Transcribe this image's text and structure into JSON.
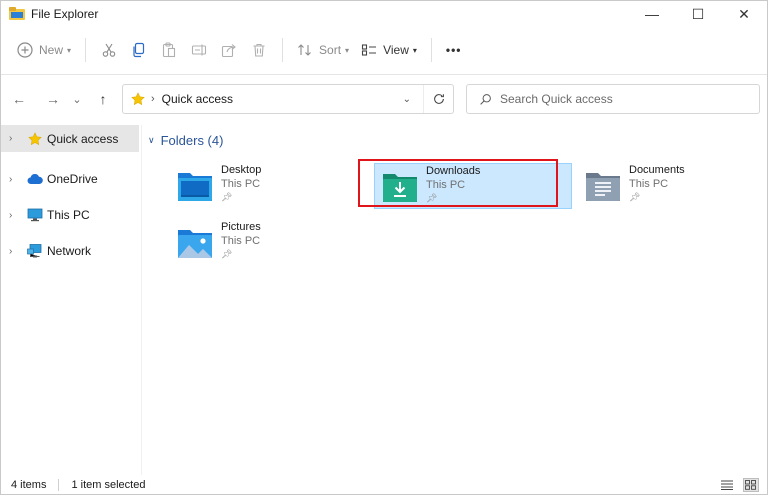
{
  "window": {
    "title": "File Explorer",
    "controls": {
      "minimize": "—",
      "maximize": "☐",
      "close": "✕"
    }
  },
  "toolbar": {
    "new_label": "New",
    "sort_label": "Sort",
    "view_label": "View",
    "more_label": "•••",
    "icons": [
      "cut-icon",
      "copy-icon",
      "paste-icon",
      "rename-icon",
      "share-icon",
      "delete-icon"
    ]
  },
  "nav": {
    "back": "←",
    "forward": "→",
    "recent": "⌄",
    "up": "↑"
  },
  "address": {
    "location": "Quick access"
  },
  "search": {
    "placeholder": "Search Quick access"
  },
  "sidebar": {
    "items": [
      {
        "label": "Quick access",
        "icon": "star-icon",
        "selected": true
      },
      {
        "label": "OneDrive",
        "icon": "cloud-icon",
        "selected": false
      },
      {
        "label": "This PC",
        "icon": "monitor-icon",
        "selected": false
      },
      {
        "label": "Network",
        "icon": "network-icon",
        "selected": false
      }
    ]
  },
  "main": {
    "group_header": "Folders (4)",
    "folders": [
      {
        "name": "Desktop",
        "location": "This PC",
        "icon": "desktop-folder-icon"
      },
      {
        "name": "Downloads",
        "location": "This PC",
        "icon": "downloads-folder-icon",
        "selected": true
      },
      {
        "name": "Documents",
        "location": "This PC",
        "icon": "documents-folder-icon"
      },
      {
        "name": "Pictures",
        "location": "This PC",
        "icon": "pictures-folder-icon"
      }
    ]
  },
  "status": {
    "item_count": "4 items",
    "selection": "1 item selected"
  },
  "colors": {
    "accent": "#2a5599",
    "selection_bg": "#cce8ff",
    "highlight_border": "#e0151b"
  }
}
